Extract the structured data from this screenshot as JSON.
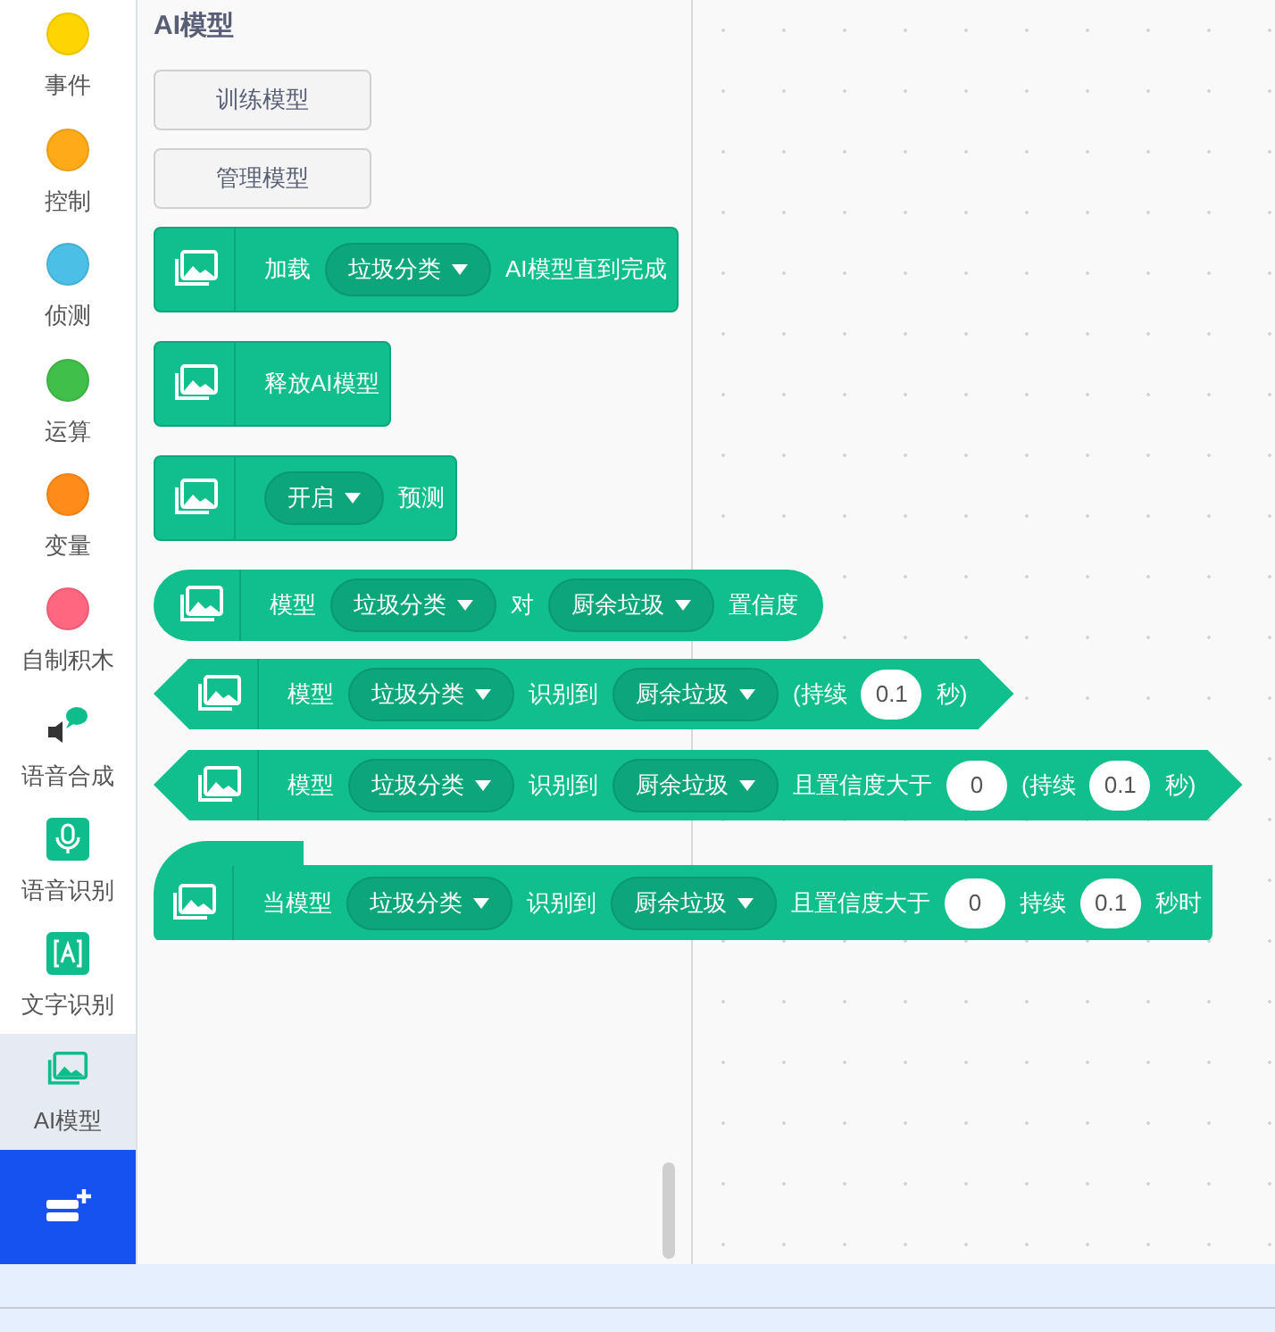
{
  "categories": [
    {
      "label": "事件",
      "kind": "dot",
      "color": "#ffd500",
      "selected": false
    },
    {
      "label": "控制",
      "kind": "dot",
      "color": "#ffab19",
      "selected": false
    },
    {
      "label": "侦测",
      "kind": "dot",
      "color": "#4cbfe6",
      "selected": false
    },
    {
      "label": "运算",
      "kind": "dot",
      "color": "#40bf4a",
      "selected": false
    },
    {
      "label": "变量",
      "kind": "dot",
      "color": "#ff8c1a",
      "selected": false
    },
    {
      "label": "自制积木",
      "kind": "dot",
      "color": "#ff6680",
      "selected": false
    },
    {
      "label": "语音合成",
      "kind": "speaker",
      "selected": false
    },
    {
      "label": "语音识别",
      "kind": "mic",
      "selected": false
    },
    {
      "label": "文字识别",
      "kind": "text",
      "selected": false
    },
    {
      "label": "AI模型",
      "kind": "image",
      "selected": true
    }
  ],
  "palette": {
    "title": "AI模型",
    "buttons": [
      "训练模型",
      "管理模型"
    ],
    "blocks": [
      {
        "kind": "stack",
        "parts": [
          {
            "kind": "text",
            "text": "加载"
          },
          {
            "kind": "dropdown",
            "text": "垃圾分类"
          },
          {
            "kind": "text",
            "text": "AI模型直到完成"
          }
        ]
      },
      {
        "kind": "stack",
        "parts": [
          {
            "kind": "text",
            "text": "释放AI模型"
          }
        ]
      },
      {
        "kind": "stack",
        "parts": [
          {
            "kind": "dropdown",
            "text": "开启"
          },
          {
            "kind": "text",
            "text": "预测"
          }
        ]
      },
      {
        "kind": "reporter",
        "parts": [
          {
            "kind": "text",
            "text": "模型"
          },
          {
            "kind": "dropdown",
            "text": "垃圾分类"
          },
          {
            "kind": "text",
            "text": "对"
          },
          {
            "kind": "dropdown",
            "text": "厨余垃圾"
          },
          {
            "kind": "text",
            "text": "置信度"
          }
        ]
      },
      {
        "kind": "boolean",
        "parts": [
          {
            "kind": "text",
            "text": "模型"
          },
          {
            "kind": "dropdown",
            "text": "垃圾分类"
          },
          {
            "kind": "text",
            "text": "识别到"
          },
          {
            "kind": "dropdown",
            "text": "厨余垃圾"
          },
          {
            "kind": "text",
            "text": "(持续"
          },
          {
            "kind": "input",
            "text": "0.1"
          },
          {
            "kind": "text",
            "text": "秒)"
          }
        ]
      },
      {
        "kind": "boolean",
        "parts": [
          {
            "kind": "text",
            "text": "模型"
          },
          {
            "kind": "dropdown",
            "text": "垃圾分类"
          },
          {
            "kind": "text",
            "text": "识别到"
          },
          {
            "kind": "dropdown",
            "text": "厨余垃圾"
          },
          {
            "kind": "text",
            "text": "且置信度大于"
          },
          {
            "kind": "input",
            "text": "0"
          },
          {
            "kind": "text",
            "text": "(持续"
          },
          {
            "kind": "input",
            "text": "0.1"
          },
          {
            "kind": "text",
            "text": "秒)"
          }
        ]
      },
      {
        "kind": "hat",
        "parts": [
          {
            "kind": "text",
            "text": "当模型"
          },
          {
            "kind": "dropdown",
            "text": "垃圾分类"
          },
          {
            "kind": "text",
            "text": "识别到"
          },
          {
            "kind": "dropdown",
            "text": "厨余垃圾"
          },
          {
            "kind": "text",
            "text": "且置信度大于"
          },
          {
            "kind": "input",
            "text": "0"
          },
          {
            "kind": "text",
            "text": "持续"
          },
          {
            "kind": "input",
            "text": "0.1"
          },
          {
            "kind": "text",
            "text": "秒时"
          }
        ]
      }
    ]
  }
}
